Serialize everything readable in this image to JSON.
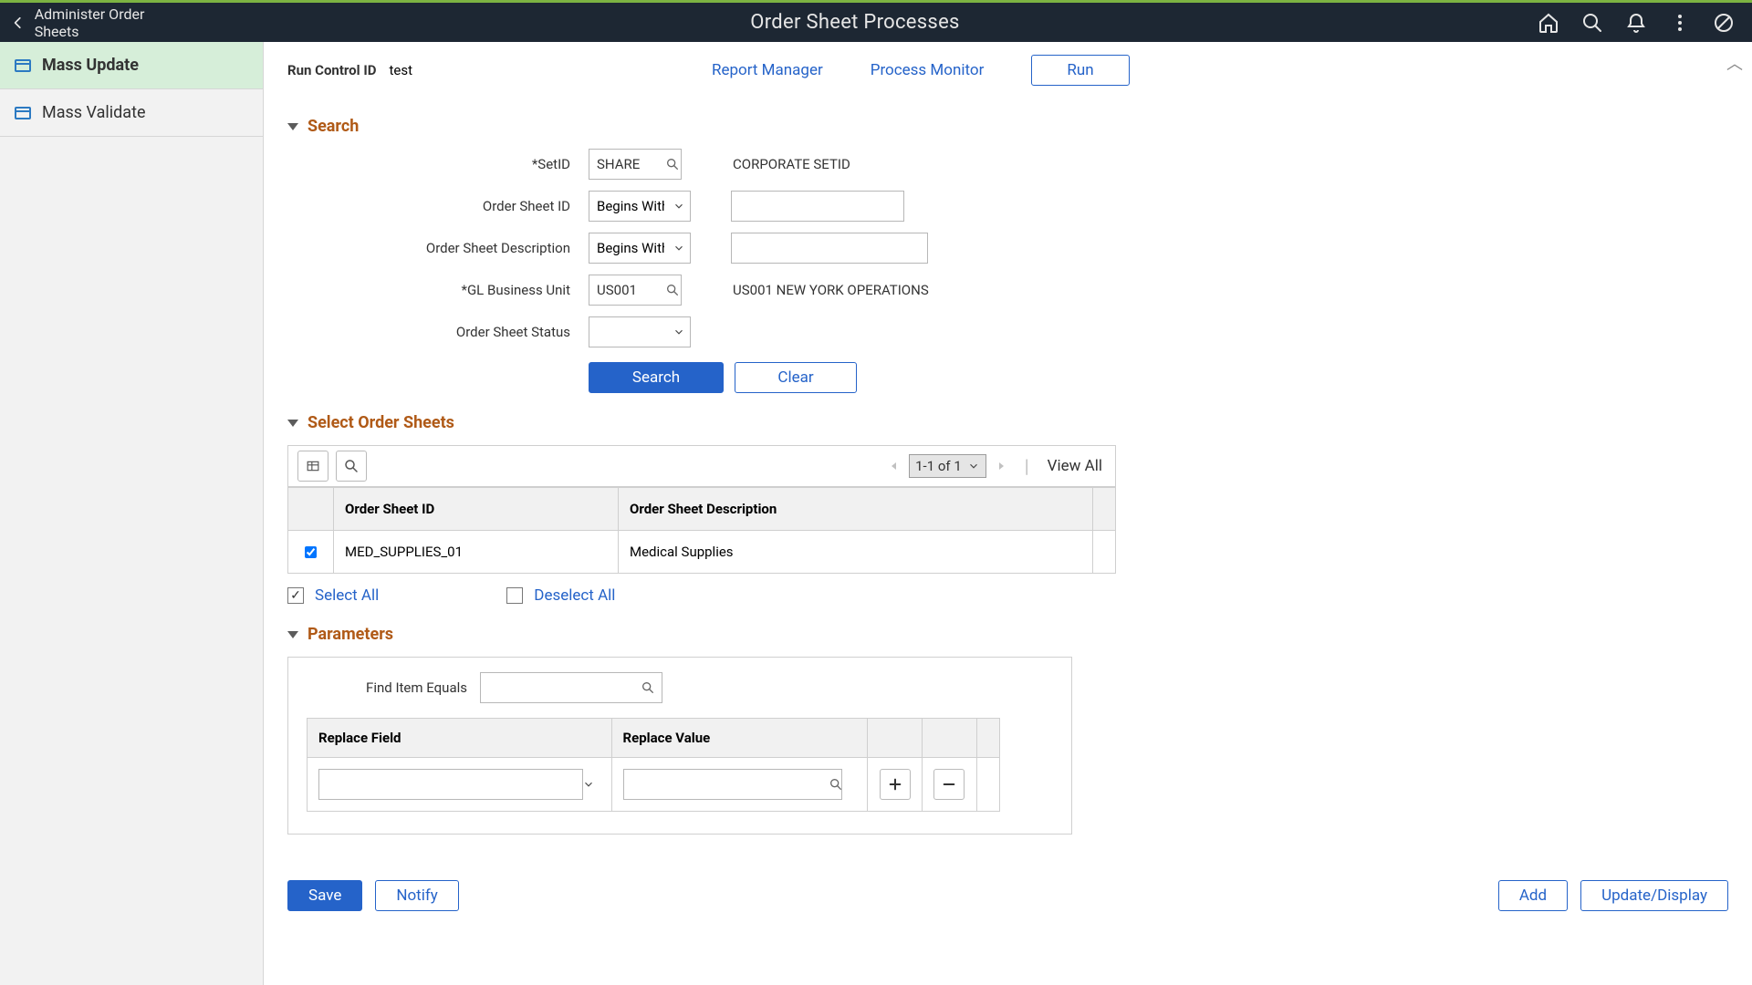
{
  "header": {
    "back_label": "Administer Order Sheets",
    "title": "Order Sheet Processes"
  },
  "sidebar": {
    "items": [
      {
        "label": "Mass Update",
        "active": true
      },
      {
        "label": "Mass Validate",
        "active": false
      }
    ]
  },
  "run": {
    "label": "Run Control ID",
    "value": "test",
    "links": [
      "Report Manager",
      "Process Monitor"
    ],
    "run_btn": "Run"
  },
  "search": {
    "title": "Search",
    "rows": {
      "setid": {
        "label": "*SetID",
        "value": "SHARE",
        "desc": "CORPORATE SETID"
      },
      "sheet_id": {
        "label": "Order Sheet ID",
        "op": "Begins With",
        "value": ""
      },
      "sheet_desc": {
        "label": "Order Sheet Description",
        "op": "Begins With",
        "value": ""
      },
      "gl_bu": {
        "label": "*GL Business Unit",
        "value": "US001",
        "desc": "US001 NEW YORK OPERATIONS"
      },
      "status": {
        "label": "Order Sheet Status",
        "value": ""
      }
    },
    "buttons": {
      "search": "Search",
      "clear": "Clear"
    }
  },
  "select_sheets": {
    "title": "Select Order Sheets",
    "range": "1-1 of 1",
    "view_all": "View All",
    "columns": [
      "Order Sheet ID",
      "Order Sheet Description"
    ],
    "rows": [
      {
        "checked": true,
        "id": "MED_SUPPLIES_01",
        "desc": "Medical Supplies"
      }
    ],
    "select_all": "Select All",
    "deselect_all": "Deselect All"
  },
  "parameters": {
    "title": "Parameters",
    "find_item": {
      "label": "Find Item Equals",
      "value": ""
    },
    "columns": [
      "Replace Field",
      "Replace Value"
    ],
    "rows": [
      {
        "field": "",
        "value": ""
      }
    ]
  },
  "footer": {
    "save": "Save",
    "notify": "Notify",
    "add": "Add",
    "update": "Update/Display"
  }
}
